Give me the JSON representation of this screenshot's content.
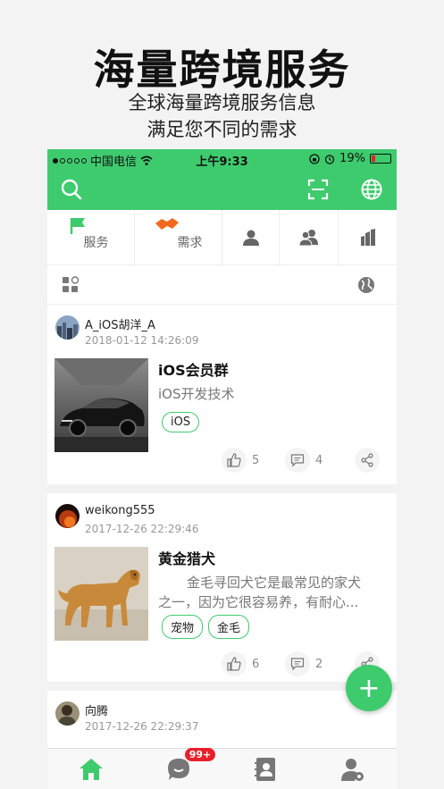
{
  "promo": {
    "title": "海量跨境服务",
    "subtitle1": "全球海量跨境服务信息",
    "subtitle2": "满足您不同的需求"
  },
  "status_bar": {
    "carrier": "中国电信",
    "time": "上午9:33",
    "battery": "19%",
    "battery_level": 0.19
  },
  "colors": {
    "accent": "#3ecb6d",
    "tag_border": "#3ecb6d",
    "badge": "#e8202b"
  },
  "navbar": {
    "left_icon": "search-icon",
    "right_icons": [
      "scan-icon",
      "globe-icon"
    ]
  },
  "categories": [
    {
      "label": "服务",
      "icon": "flag-icon"
    },
    {
      "label": "需求",
      "icon": "handshake-icon"
    },
    {
      "label": "",
      "icon": "person-icon"
    },
    {
      "label": "",
      "icon": "group-icon"
    },
    {
      "label": "",
      "icon": "building-icon"
    }
  ],
  "posts": [
    {
      "user": "A_iOS胡洋_A",
      "time": "2018-01-12 14:26:09",
      "title": "iOS会员群",
      "desc": "iOS开发技术",
      "tags": [
        "iOS"
      ],
      "likes": "5",
      "comments": "4"
    },
    {
      "user": "weikong555",
      "time": "2017-12-26 22:29:46",
      "title": "黄金猎犬",
      "desc_line1": "金毛寻回犬它是最常见的家犬",
      "desc_line2": "之一，因为它很容易养，有耐心...",
      "tags": [
        "宠物",
        "金毛"
      ],
      "likes": "6",
      "comments": "2"
    },
    {
      "user": "向腾",
      "time": "2017-12-26 22:29:37"
    }
  ],
  "fab": {
    "label": "+"
  },
  "tabbar": {
    "tabs": [
      "home-icon",
      "chat-icon",
      "contacts-icon",
      "user-settings-icon"
    ],
    "badge": "99+"
  }
}
